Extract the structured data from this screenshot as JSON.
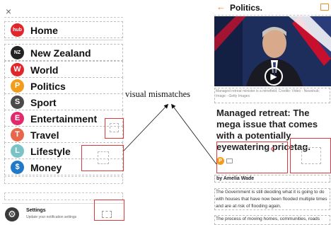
{
  "annotation": {
    "caption": "visual mismatches"
  },
  "left_menu": {
    "close_glyph": "×",
    "items": [
      {
        "label": "Home",
        "badge": "hub",
        "color": "#e1262b",
        "icon": "hub-logo-icon"
      },
      {
        "label": "New Zealand",
        "badge": "NZ",
        "color": "#222222",
        "icon": "nz-badge-icon"
      },
      {
        "label": "World",
        "badge": "W",
        "color": "#e1262b",
        "icon": "world-badge-icon"
      },
      {
        "label": "Politics",
        "badge": "P",
        "color": "#f29c1c",
        "icon": "politics-badge-icon"
      },
      {
        "label": "Sport",
        "badge": "S",
        "color": "#4a4a4a",
        "icon": "sport-badge-icon"
      },
      {
        "label": "Entertainment",
        "badge": "E",
        "color": "#e12a6b",
        "icon": "entertainment-badge-icon"
      },
      {
        "label": "Travel",
        "badge": "T",
        "color": "#e8664b",
        "icon": "travel-badge-icon"
      },
      {
        "label": "Lifestyle",
        "badge": "L",
        "color": "#7ac4c8",
        "icon": "lifestyle-badge-icon"
      },
      {
        "label": "Money",
        "badge": "$",
        "color": "#1f78c8",
        "icon": "money-badge-icon"
      }
    ],
    "settings": {
      "title": "Settings",
      "subtitle": "Update your notification settings",
      "icon": "gear-icon"
    }
  },
  "article": {
    "section": "Politics.",
    "back_glyph": "←",
    "play_glyph": "▶",
    "image_caption": "Managed retreat minister is a minefield. Credits: Video - Newshub; Image - Getty Images",
    "headline": "Managed retreat: The mega issue that comes with a potentially eyewatering pricetag.",
    "author_badge": "P",
    "byline": "by Amelia Wade",
    "paragraphs": [
      "The Government is still deciding what it is going to do with houses that have now been flooded multiple times and are at risk of flooding again.",
      "The process of moving homes, communities, roads"
    ],
    "accent_color": "#f08a1c",
    "annotation_color": "#e0393b"
  }
}
